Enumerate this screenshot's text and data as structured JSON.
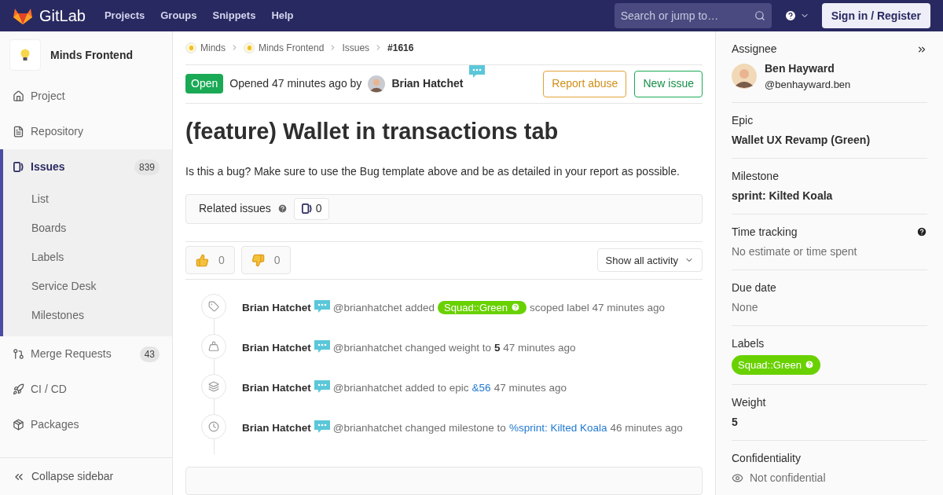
{
  "navbar": {
    "brand": "GitLab",
    "links": [
      "Projects",
      "Groups",
      "Snippets",
      "Help"
    ],
    "search": {
      "placeholder": "Search or jump to…"
    },
    "sign_in": "Sign in / Register"
  },
  "sidebar": {
    "project": "Minds Frontend",
    "items": [
      {
        "kind": "project",
        "label": "Project",
        "selected": false
      },
      {
        "kind": "repository",
        "label": "Repository",
        "selected": false
      },
      {
        "kind": "issues",
        "label": "Issues",
        "count": "839",
        "selected": true,
        "children": [
          {
            "label": "List"
          },
          {
            "label": "Boards"
          },
          {
            "label": "Labels"
          },
          {
            "label": "Service Desk"
          },
          {
            "label": "Milestones"
          }
        ]
      },
      {
        "kind": "merge",
        "label": "Merge Requests",
        "count": "43",
        "selected": false
      },
      {
        "kind": "cicd",
        "label": "CI / CD",
        "selected": false
      },
      {
        "kind": "packages",
        "label": "Packages",
        "selected": false
      }
    ],
    "collapse": "Collapse sidebar"
  },
  "breadcrumbs": [
    {
      "label": "Minds",
      "avatar": true
    },
    {
      "label": "Minds Frontend",
      "avatar": true
    },
    {
      "label": "Issues",
      "avatar": false
    },
    {
      "label": "#1616",
      "avatar": false
    }
  ],
  "issue": {
    "status": "Open",
    "opened": "Opened 47 minutes ago by",
    "author": "Brian Hatchet",
    "buttons": [
      {
        "kind": "warning",
        "label": "Report abuse"
      },
      {
        "kind": "success",
        "label": "New issue"
      }
    ],
    "title": "(feature) Wallet in transactions tab",
    "description": "Is this a bug? Make sure to use the Bug template above and be as detailed in your report as possible.",
    "related": {
      "label": "Related issues",
      "count": "0"
    },
    "reactions": [
      {
        "kind": "thumbsup",
        "count": "0"
      },
      {
        "kind": "thumbsdown",
        "count": "0"
      }
    ],
    "activity_filter": "Show all activity"
  },
  "activities": [
    {
      "kind": "label",
      "author": "Brian Hatchet",
      "parts": [
        {
          "kind": "text",
          "text": "@brianhatchet added"
        },
        {
          "kind": "label",
          "text": "Squad::Green",
          "color": "#69d100"
        },
        {
          "kind": "text",
          "text": "scoped label 47 minutes ago"
        }
      ]
    },
    {
      "kind": "weight",
      "author": "Brian Hatchet",
      "parts": [
        {
          "kind": "text",
          "text": "@brianhatchet changed weight to **5** 47 minutes ago"
        }
      ]
    },
    {
      "kind": "epic",
      "author": "Brian Hatchet",
      "parts": [
        {
          "kind": "text",
          "text": "@brianhatchet added to epic"
        },
        {
          "kind": "link",
          "text": "&56"
        },
        {
          "kind": "text",
          "text": "47 minutes ago"
        }
      ]
    },
    {
      "kind": "milestone",
      "author": "Brian Hatchet",
      "parts": [
        {
          "kind": "text",
          "text": "@brianhatchet changed milestone to"
        },
        {
          "kind": "link",
          "text": "%sprint: Kilted Koala"
        },
        {
          "kind": "text",
          "text": "46 minutes ago"
        }
      ]
    }
  ],
  "right_sidebar": {
    "assignee": {
      "title": "Assignee",
      "name": "Ben Hayward",
      "username": "@benhayward.ben"
    },
    "sections": [
      {
        "kind": "bold",
        "title": "Epic",
        "value": "Wallet UX Revamp (Green)"
      },
      {
        "kind": "bold",
        "title": "Milestone",
        "value": "sprint: Kilted Koala"
      },
      {
        "kind": "help",
        "title": "Time tracking",
        "value": "No estimate or time spent"
      },
      {
        "kind": "muted",
        "title": "Due date",
        "value": "None"
      },
      {
        "kind": "label",
        "title": "Labels",
        "value": "Squad::Green",
        "color": "#69d100"
      },
      {
        "kind": "bold",
        "title": "Weight",
        "value": "5"
      },
      {
        "kind": "eye",
        "title": "Confidentiality",
        "value": "Not confidential"
      }
    ]
  }
}
